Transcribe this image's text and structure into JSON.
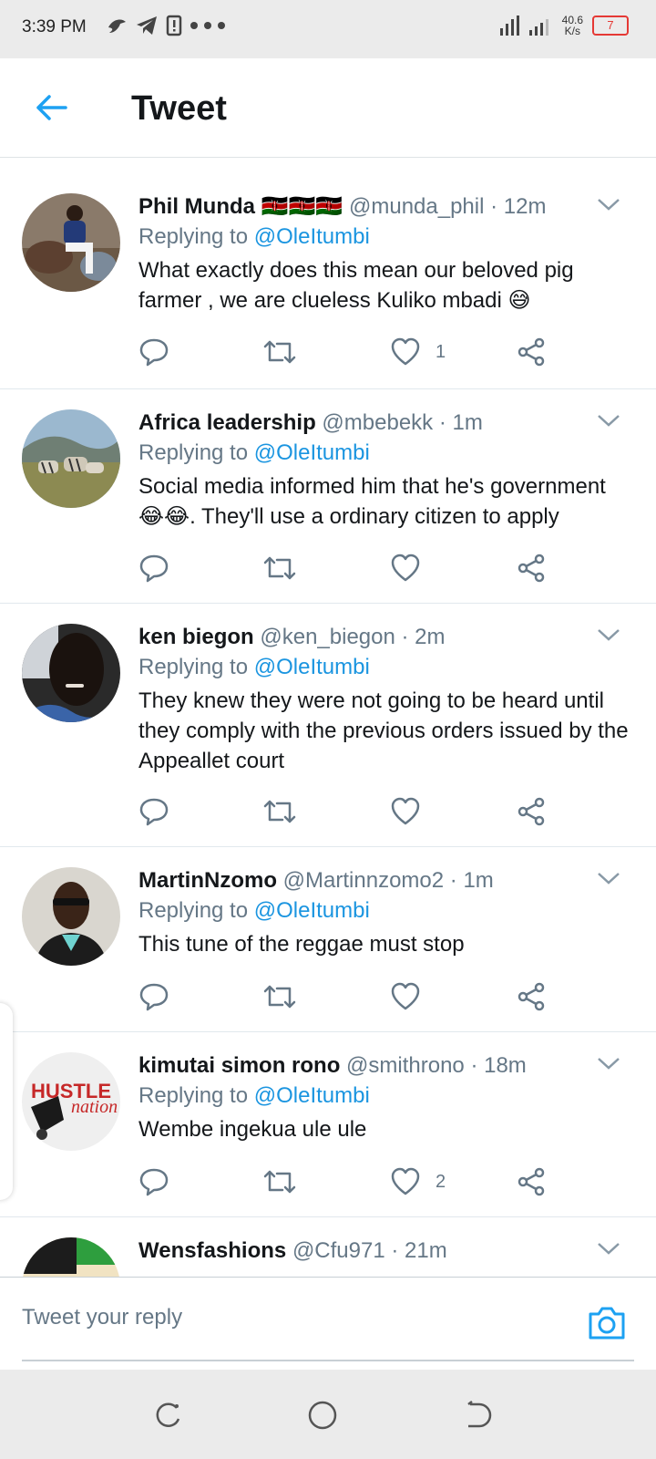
{
  "status_bar": {
    "time": "3:39 PM",
    "speed_value": "40.6",
    "speed_unit": "K/s",
    "battery": "7",
    "left_icons": [
      "bird-icon",
      "telegram-icon",
      "notification-icon",
      "more-dots-icon"
    ]
  },
  "header": {
    "title": "Tweet",
    "back_icon": "arrow-left-icon"
  },
  "colors": {
    "accent": "#1da1f2",
    "link": "#1b95e0",
    "muted": "#657786",
    "text": "#14171a",
    "battery": "#e53935"
  },
  "tweets": [
    {
      "name": "Phil Munda 🇰🇪🇰🇪🇰🇪",
      "handle": "@munda_phil",
      "time": "· 12m",
      "replying_label": "Replying to",
      "replying_to": "@OleItumbi",
      "text": "What exactly does this mean our beloved pig farmer , we are clueless Kuliko mbadi 😅",
      "like_count": "1"
    },
    {
      "name": "Africa leadership",
      "handle": "@mbebekk",
      "time": "· 1m",
      "replying_label": "Replying to",
      "replying_to": "@OleItumbi",
      "text": "Social media informed him that he's government 😂😂. They'll use a ordinary citizen to apply",
      "like_count": ""
    },
    {
      "name": "ken biegon",
      "handle": "@ken_biegon",
      "time": "· 2m",
      "replying_label": "Replying to",
      "replying_to": "@OleItumbi",
      "text": "They knew they were not going to be heard until they comply with the previous orders issued by the Appeallet court",
      "like_count": ""
    },
    {
      "name": "MartinNzomo",
      "handle": "@Martinnzomo2",
      "time": "· 1m",
      "replying_label": "Replying to",
      "replying_to": "@OleItumbi",
      "text": "This tune of the reggae must stop",
      "like_count": ""
    },
    {
      "name": "kimutai simon rono",
      "handle": "@smithrono",
      "time": "· 18m",
      "replying_label": "Replying to",
      "replying_to": "@OleItumbi",
      "text": "Wembe ingekua ule ule",
      "like_count": "2",
      "avatar_text_1": "HUSTLE",
      "avatar_text_2": "nation"
    },
    {
      "name": "Wensfashions",
      "handle": "@Cfu971",
      "time": "· 21m"
    }
  ],
  "reply_bar": {
    "placeholder": "Tweet your reply",
    "camera_icon": "camera-icon"
  },
  "nav_bar": {
    "icons": [
      "recent-apps-icon",
      "home-icon",
      "back-icon"
    ]
  }
}
